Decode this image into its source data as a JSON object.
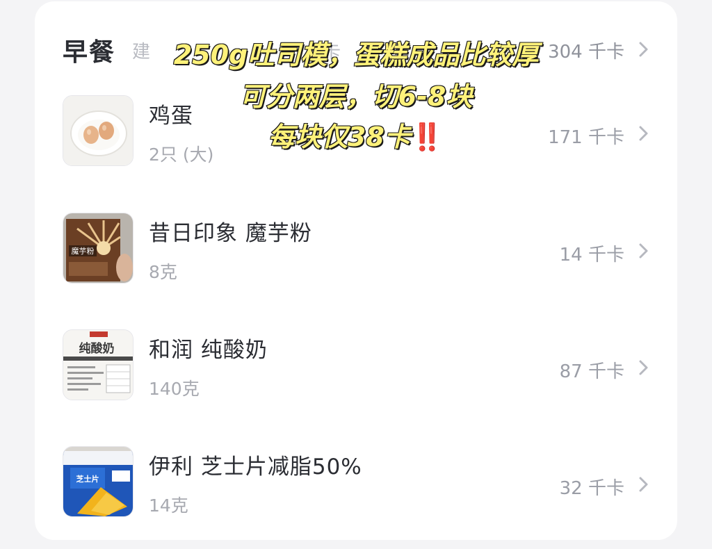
{
  "meal": {
    "title": "早餐",
    "hint_left": "建",
    "hint_right": "卡",
    "total_kcal": "304 千卡"
  },
  "foods": [
    {
      "name": "鸡蛋",
      "quantity": "2只 (大)",
      "kcal": "171 千卡",
      "thumb": "egg-photo"
    },
    {
      "name": "昔日印象 魔芋粉",
      "quantity": "8克",
      "kcal": "14 千卡",
      "thumb": "konjac-package-photo",
      "thumb_text": "魔芋粉"
    },
    {
      "name": "和润 纯酸奶",
      "quantity": "140克",
      "kcal": "87 千卡",
      "thumb": "yogurt-lid-photo",
      "thumb_text": "纯酸奶"
    },
    {
      "name": "伊利 芝士片减脂50%",
      "quantity": "14克",
      "kcal": "32 千卡",
      "thumb": "cheese-package-photo",
      "thumb_text": "芝士片"
    }
  ],
  "overlay_caption": {
    "line1": "250g吐司模，蛋糕成品比较厚",
    "line2": "可分两层，切6-8块",
    "line3": "每块仅38卡",
    "line3_mark": "‼️"
  },
  "colors": {
    "caption_fill": "#fff27a",
    "caption_outline": "#1a1a1a",
    "mark_red": "#e21b1b"
  }
}
